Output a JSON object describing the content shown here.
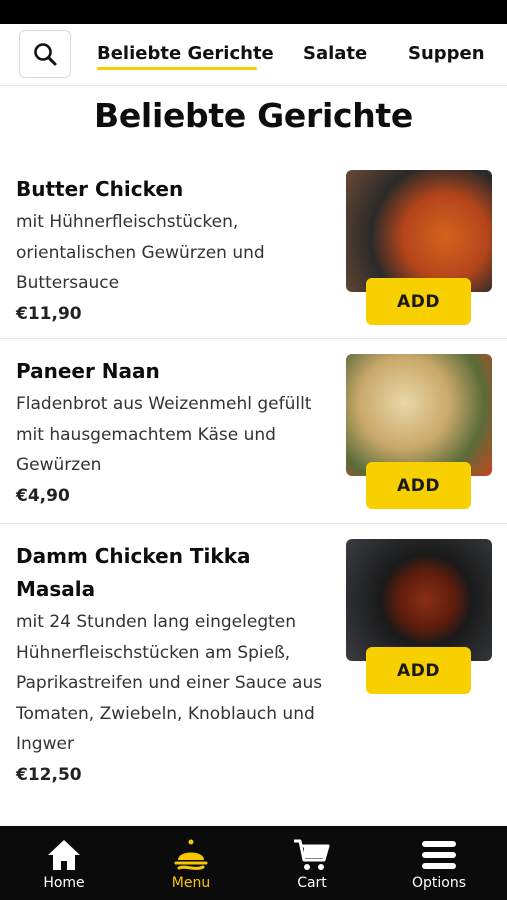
{
  "tabs": [
    {
      "label": "Beliebte Gerichte",
      "active": true
    },
    {
      "label": "Salate"
    },
    {
      "label": "Suppen"
    }
  ],
  "page_title": "Beliebte Gerichte",
  "items": [
    {
      "name": "Butter Chicken",
      "description": "mit Hühnerfleischstücken, orientalischen Gewürzen und Buttersauce",
      "price": "€11,90",
      "add_label": "ADD"
    },
    {
      "name": "Paneer Naan",
      "description": "Fladenbrot aus Weizenmehl gefüllt mit hausgemachtem Käse und Gewürzen",
      "price": "€4,90",
      "add_label": "ADD"
    },
    {
      "name": "Damm Chicken Tikka Masala",
      "description": "mit 24 Stunden lang eingelegten Hühnerfleischstücken am Spieß, Paprikastreifen und einer Sauce aus Tomaten, Zwiebeln, Knoblauch und Ingwer",
      "price": "€12,50",
      "add_label": "ADD"
    }
  ],
  "bottom_nav": [
    {
      "label": "Home",
      "icon": "home-icon"
    },
    {
      "label": "Menu",
      "icon": "menu-bell-icon",
      "active": true
    },
    {
      "label": "Cart",
      "icon": "cart-icon"
    },
    {
      "label": "Options",
      "icon": "options-icon"
    }
  ],
  "colors": {
    "accent": "#f8d000",
    "nav_bg": "#0b0b0b",
    "active_nav": "#f5c800"
  }
}
